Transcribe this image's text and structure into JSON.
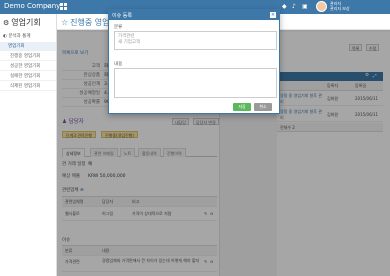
{
  "topbar": {
    "company": "Demo Company",
    "user_name": "관리자",
    "user_role": "관리자 보상"
  },
  "sidebar": {
    "app_title": "영업기회",
    "section_label": "분석과 통계",
    "active_item": "영업기회",
    "sub_items": [
      "진행중 영업기회",
      "성공한 영업기회",
      "실패한 영업기회",
      "삭제된 영업기회"
    ]
  },
  "main": {
    "page_title": "진행중 영업기회",
    "back_link": "목록으로 보기",
    "info_rows": [
      {
        "label": "고객",
        "value": "화근"
      },
      {
        "label": "관심상품",
        "value": "화근"
      },
      {
        "label": "성공인계",
        "value": "3.14"
      },
      {
        "label": "성공예정일",
        "value": "4.1"
      },
      {
        "label": "성공확률",
        "value": "90 %"
      }
    ],
    "owner_label": "담당자",
    "owner_buttons": [
      "내담당",
      "담당자 변경"
    ],
    "tags": [
      "단계3:견적진행",
      "진행중(영업진행)"
    ],
    "tabs": [
      "상세정보",
      "관련 이메일",
      "노트",
      "활동내역",
      "진행이력"
    ],
    "detail_rows": [
      {
        "label": "관 거래 일정",
        "value": "예"
      },
      {
        "label": "예상 매출",
        "value": "KRW 50,000,000"
      }
    ],
    "related_section": "관련업체",
    "related_headers": [
      "관련업체명",
      "담당자",
      "비고"
    ],
    "related_rows": [
      {
        "name": "웹사블로",
        "contact": "허그림",
        "note": "가격이 상대적으로 저렴"
      }
    ],
    "issue_section": "이슈",
    "issue_headers": [
      "분류",
      "내용"
    ],
    "issue_rows": [
      {
        "category": "가격관련",
        "content": "경쟁업체와 가격면에서 큰 차이가 있는데 어떻게 해야 할지"
      }
    ]
  },
  "right_panel": {
    "buttons": [
      "목록",
      "수정"
    ],
    "col_headers": [
      "등록자",
      "등록일"
    ],
    "rows": [
      {
        "title": "경쟁 중 영업기회 향후 관리",
        "author": "김화원",
        "date": "2015/06/11"
      },
      {
        "title": "경쟁 중 영업기회 향후 관리",
        "author": "김화원",
        "date": "2015/06/11"
      }
    ],
    "total": "전체수 2"
  },
  "modal": {
    "title": "이슈 등록",
    "category_label": "분류",
    "category_placeholder": "가격관련",
    "category_placeholder2": "새 기업고객",
    "content_label": "내용",
    "save_label": "저장",
    "cancel_label": "취소"
  },
  "colors": {
    "primary": "#3e78a8",
    "save_button": "#5cb85c",
    "cancel_button": "#999999"
  }
}
